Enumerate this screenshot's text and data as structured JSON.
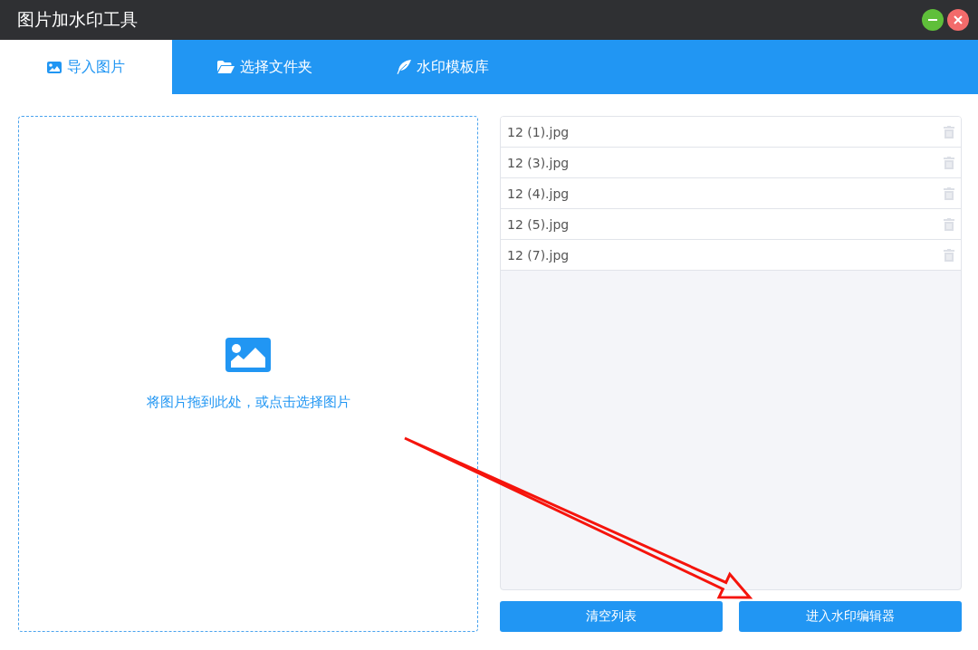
{
  "window": {
    "title": "图片加水印工具"
  },
  "tabs": [
    {
      "label": "导入图片",
      "selected": true
    },
    {
      "label": "选择文件夹",
      "selected": false
    },
    {
      "label": "水印模板库",
      "selected": false
    }
  ],
  "dropzone": {
    "hint": "将图片拖到此处，或点击选择图片"
  },
  "files": [
    "12 (1).jpg",
    "12 (3).jpg",
    "12 (4).jpg",
    "12 (5).jpg",
    "12 (7).jpg"
  ],
  "buttons": [
    "清空列表",
    "进入水印编辑器"
  ]
}
